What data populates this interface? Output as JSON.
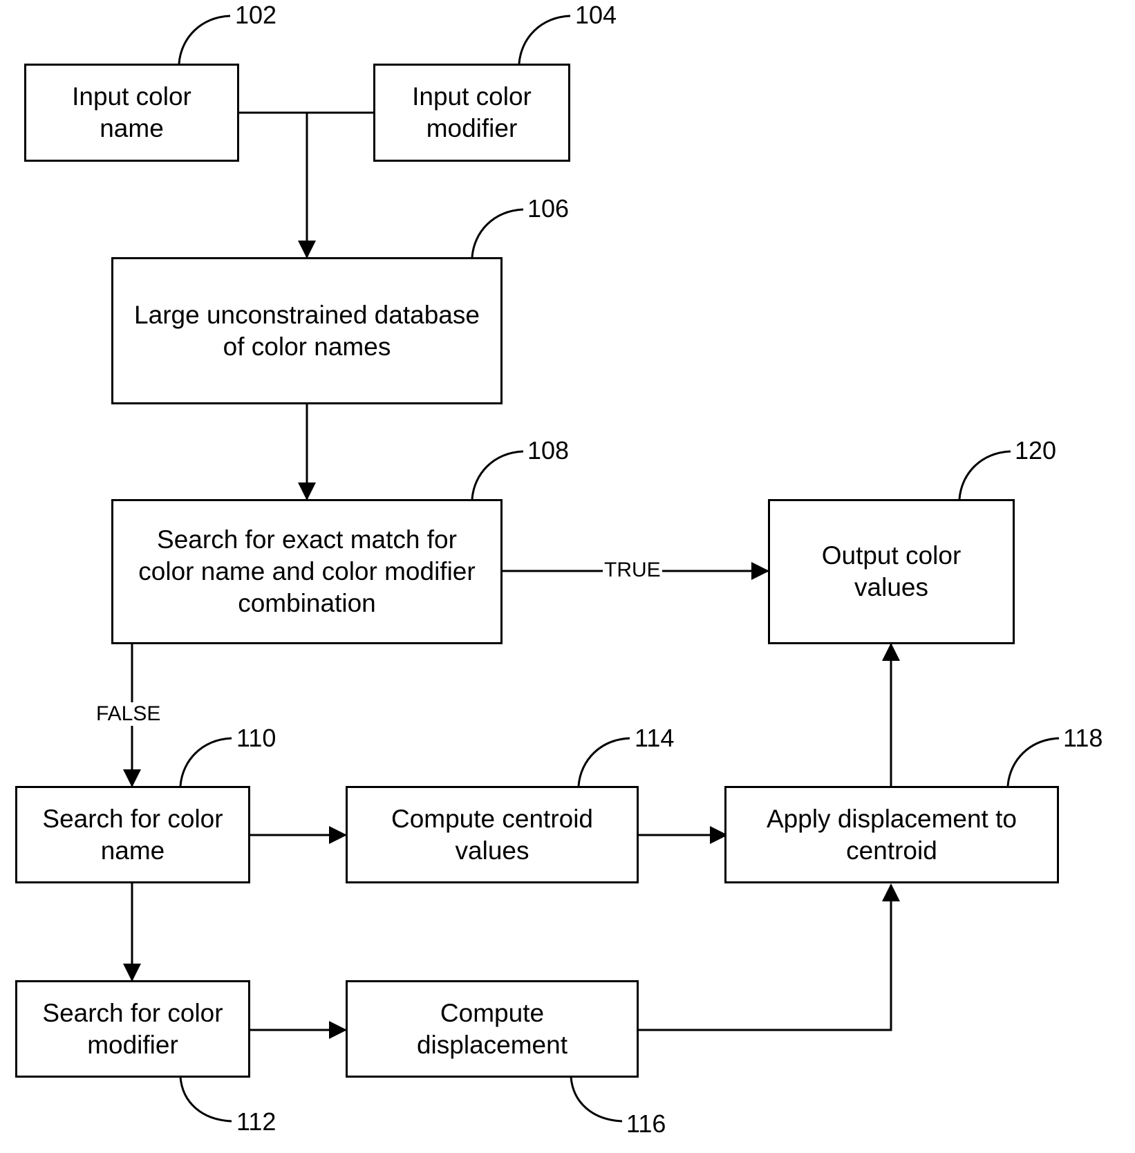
{
  "diagram": {
    "nodes": [
      {
        "id": "102",
        "label": "Input color\nname"
      },
      {
        "id": "104",
        "label": "Input color\nmodifier"
      },
      {
        "id": "106",
        "label": "Large unconstrained database\nof color names"
      },
      {
        "id": "108",
        "label": "Search for exact match for\ncolor name and color modifier\ncombination"
      },
      {
        "id": "110",
        "label": "Search for color\nname"
      },
      {
        "id": "112",
        "label": "Search for color\nmodifier"
      },
      {
        "id": "114",
        "label": "Compute centroid\nvalues"
      },
      {
        "id": "116",
        "label": "Compute\ndisplacement"
      },
      {
        "id": "118",
        "label": "Apply displacement to\ncentroid"
      },
      {
        "id": "120",
        "label": "Output color\nvalues"
      }
    ],
    "edges": [
      {
        "from": "102",
        "to": "106",
        "label": ""
      },
      {
        "from": "104",
        "to": "106",
        "label": ""
      },
      {
        "from": "106",
        "to": "108",
        "label": ""
      },
      {
        "from": "108",
        "to": "120",
        "label": "TRUE"
      },
      {
        "from": "108",
        "to": "110",
        "label": "FALSE"
      },
      {
        "from": "110",
        "to": "114",
        "label": ""
      },
      {
        "from": "110",
        "to": "112",
        "label": ""
      },
      {
        "from": "112",
        "to": "116",
        "label": ""
      },
      {
        "from": "114",
        "to": "118",
        "label": ""
      },
      {
        "from": "116",
        "to": "118",
        "label": ""
      },
      {
        "from": "118",
        "to": "120",
        "label": ""
      }
    ]
  }
}
